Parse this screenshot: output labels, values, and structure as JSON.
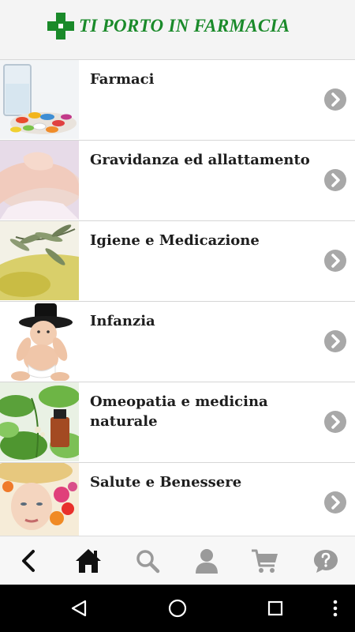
{
  "header": {
    "title": "TI PORTO IN FARMACIA"
  },
  "categories": [
    {
      "label": "Farmaci",
      "image": "pills-glass-image"
    },
    {
      "label": "Gravidanza ed allattamento",
      "image": "baby-hands-image"
    },
    {
      "label": "Igiene e Medicazione",
      "image": "olive-branch-image"
    },
    {
      "label": "Infanzia",
      "image": "baby-in-hat-image"
    },
    {
      "label": "Omeopatia e medicina naturale",
      "image": "herbs-bottle-image"
    },
    {
      "label": "Salute e Benessere",
      "image": "woman-flowers-image"
    }
  ],
  "bottom_tabs": [
    {
      "name": "back",
      "icon": "chevron-left-icon"
    },
    {
      "name": "home",
      "icon": "home-icon",
      "active": true
    },
    {
      "name": "search",
      "icon": "search-icon"
    },
    {
      "name": "account",
      "icon": "user-icon"
    },
    {
      "name": "cart",
      "icon": "cart-icon"
    },
    {
      "name": "help",
      "icon": "help-icon"
    }
  ],
  "system_nav": [
    "back-triangle-icon",
    "home-circle-icon",
    "recents-square-icon",
    "more-vert-icon"
  ],
  "colors": {
    "brand_green": "#1a8a2a",
    "chevron_gray": "#a8a8a8",
    "icon_gray": "#9a9a9a"
  }
}
